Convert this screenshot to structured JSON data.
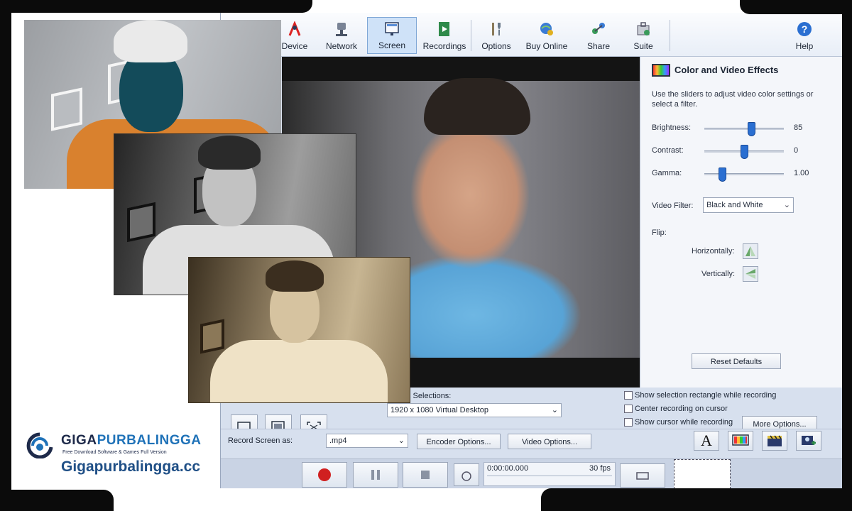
{
  "toolbar": {
    "items": [
      {
        "label": "Device",
        "icon": "device-icon"
      },
      {
        "label": "Network",
        "icon": "network-icon"
      },
      {
        "label": "Screen",
        "icon": "screen-icon"
      },
      {
        "label": "Recordings",
        "icon": "recordings-icon"
      },
      {
        "label": "Options",
        "icon": "options-icon"
      },
      {
        "label": "Buy Online",
        "icon": "buy-online-icon"
      },
      {
        "label": "Share",
        "icon": "share-icon"
      },
      {
        "label": "Suite",
        "icon": "suite-icon"
      },
      {
        "label": "Help",
        "icon": "help-icon"
      }
    ],
    "active": "Screen"
  },
  "effects": {
    "title": "Color and Video Effects",
    "description": "Use the sliders to adjust video color settings or select a filter.",
    "brightness": {
      "label": "Brightness:",
      "value": "85",
      "level": 0.6
    },
    "contrast": {
      "label": "Contrast:",
      "value": "0",
      "level": 0.5
    },
    "gamma": {
      "label": "Gamma:",
      "value": "1.00",
      "level": 0.2
    },
    "video_filter_label": "Video Filter:",
    "video_filter_value": "Black and White",
    "flip_label": "Flip:",
    "horizontally_label": "Horizontally:",
    "vertically_label": "Vertically:",
    "reset_label": "Reset Defaults"
  },
  "selection": {
    "label": "s Selections:",
    "value": "1920 x 1080 Virtual Desktop",
    "checkboxes": [
      "Show selection rectangle while recording",
      "Center recording on cursor",
      "Show cursor while recording"
    ],
    "more_options": "More Options..."
  },
  "record": {
    "label": "Record Screen as:",
    "format": ".mp4",
    "encoder_options": "Encoder Options...",
    "video_options": "Video Options...",
    "time": "0:00:00.000",
    "fps": "30 fps"
  },
  "watermark": {
    "brand_a": "GIGA",
    "brand_b": "PURBALINGGA",
    "tagline": "Free Download Software & Games Full Version",
    "url": "Gigapurbalingga.cc"
  },
  "colors": {
    "accent": "#2b6fd1",
    "toolbar_active": "#cfe2f8",
    "brand_dark": "#1e2a4a",
    "brand_blue": "#1f72b8"
  }
}
